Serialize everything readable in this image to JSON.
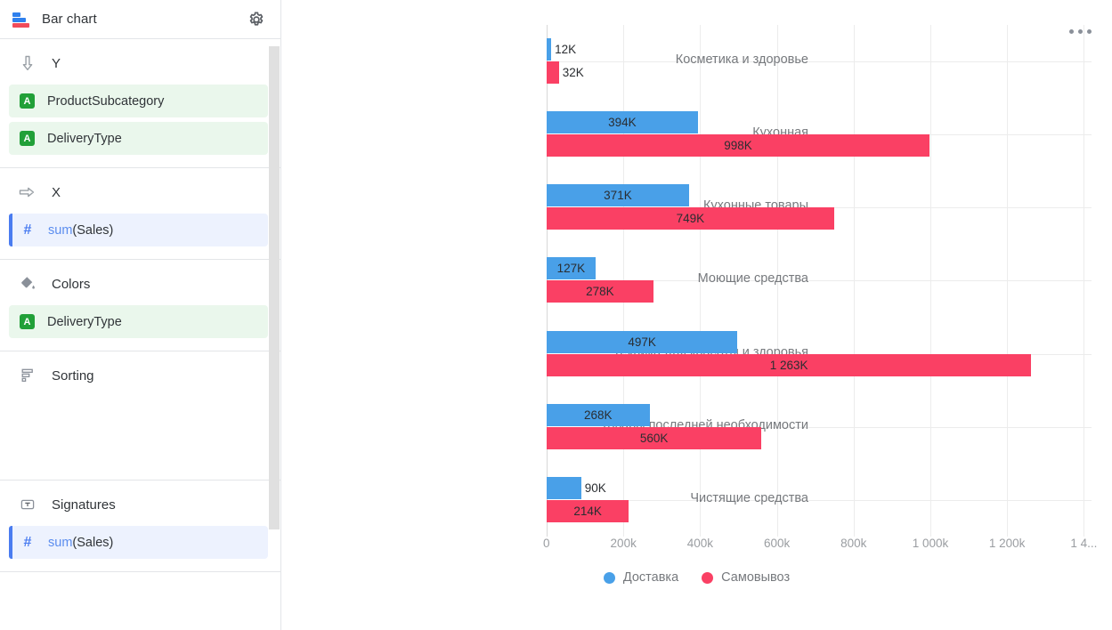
{
  "sidebar": {
    "header": {
      "title": "Bar chart",
      "chart_icon": "bar-chart-icon",
      "settings_icon": "gear-icon"
    },
    "sections": [
      {
        "key": "y",
        "label": "Y",
        "icon": "arrow-down-icon",
        "fields": [
          {
            "label": "ProductSubcategory",
            "kind": "dimension",
            "badge": "A"
          },
          {
            "label": "DeliveryType",
            "kind": "dimension",
            "badge": "A"
          }
        ]
      },
      {
        "key": "x",
        "label": "X",
        "icon": "arrow-right-icon",
        "fields": [
          {
            "label": "sum(Sales)",
            "fn": "sum",
            "arg": "(Sales)",
            "kind": "measure",
            "badge": "#"
          }
        ]
      },
      {
        "key": "colors",
        "label": "Colors",
        "icon": "paint-bucket-icon",
        "fields": [
          {
            "label": "DeliveryType",
            "kind": "dimension",
            "badge": "A"
          }
        ]
      },
      {
        "key": "sorting",
        "label": "Sorting",
        "icon": "sort-icon",
        "fields": []
      },
      {
        "key": "signatures",
        "label": "Signatures",
        "icon": "text-box-icon",
        "fields": [
          {
            "label": "sum(Sales)",
            "fn": "sum",
            "arg": "(Sales)",
            "kind": "measure",
            "badge": "#"
          }
        ]
      }
    ]
  },
  "chart_panel": {
    "menu_icon": "kebab-menu-icon"
  },
  "chart_data": {
    "type": "bar",
    "orientation": "horizontal",
    "title": "",
    "xlabel": "",
    "ylabel": "",
    "grid": true,
    "legend_position": "bottom",
    "xlim": [
      0,
      1420000
    ],
    "xticks": [
      0,
      200000,
      400000,
      600000,
      800000,
      1000000,
      1200000,
      1400000
    ],
    "xtick_labels": [
      "0",
      "200k",
      "400k",
      "600k",
      "800k",
      "1 000k",
      "1 200k",
      "1 4..."
    ],
    "categories": [
      "Косметика и здоровье",
      "Кухонная",
      "Кухонные товары",
      "Моющие средства",
      "Техника для красоты и здоровья",
      "Товары последней необходимости",
      "Чистящие средства"
    ],
    "series": [
      {
        "name": "Доставка",
        "color": "#49a0e8",
        "values": [
          12000,
          394000,
          371000,
          127000,
          497000,
          268000,
          90000
        ],
        "value_labels": [
          "12K",
          "394K",
          "371K",
          "127K",
          "497K",
          "268K",
          "90K"
        ]
      },
      {
        "name": "Самовывоз",
        "color": "#fa4064",
        "values": [
          32000,
          998000,
          749000,
          278000,
          1263000,
          560000,
          214000
        ],
        "value_labels": [
          "32K",
          "998K",
          "749K",
          "278K",
          "1 263K",
          "560K",
          "214K"
        ]
      }
    ]
  }
}
